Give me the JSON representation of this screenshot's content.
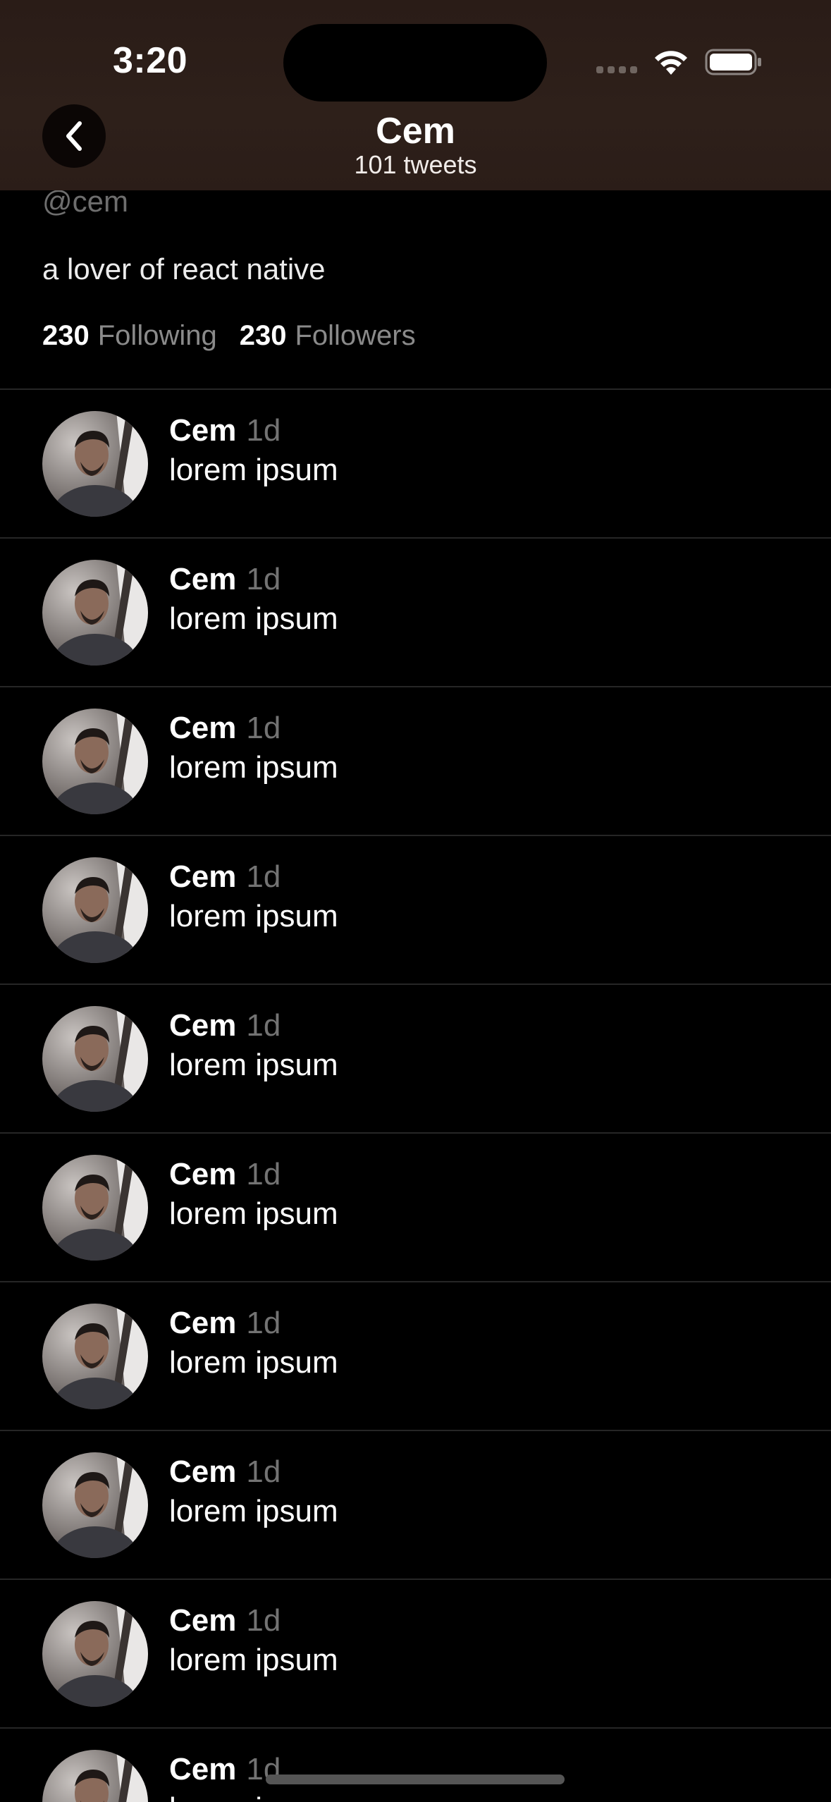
{
  "status_bar": {
    "time": "3:20"
  },
  "header": {
    "title": "Cem",
    "subtitle": "101 tweets"
  },
  "profile": {
    "handle": "@cem",
    "bio": "a lover of react native",
    "following_count": "230",
    "following_label": "Following",
    "followers_count": "230",
    "followers_label": "Followers"
  },
  "tweets": [
    {
      "name": "Cem",
      "time": "1d",
      "text": "lorem ipsum"
    },
    {
      "name": "Cem",
      "time": "1d",
      "text": "lorem ipsum"
    },
    {
      "name": "Cem",
      "time": "1d",
      "text": "lorem ipsum"
    },
    {
      "name": "Cem",
      "time": "1d",
      "text": "lorem ipsum"
    },
    {
      "name": "Cem",
      "time": "1d",
      "text": "lorem ipsum"
    },
    {
      "name": "Cem",
      "time": "1d",
      "text": "lorem ipsum"
    },
    {
      "name": "Cem",
      "time": "1d",
      "text": "lorem ipsum"
    },
    {
      "name": "Cem",
      "time": "1d",
      "text": "lorem ipsum"
    },
    {
      "name": "Cem",
      "time": "1d",
      "text": "lorem ipsum"
    },
    {
      "name": "Cem",
      "time": "1d",
      "text": "lorem ipsum"
    }
  ],
  "icons": {
    "back": "chevron-left-icon",
    "wifi": "wifi-icon",
    "battery": "battery-icon",
    "signal": "signal-icon"
  }
}
